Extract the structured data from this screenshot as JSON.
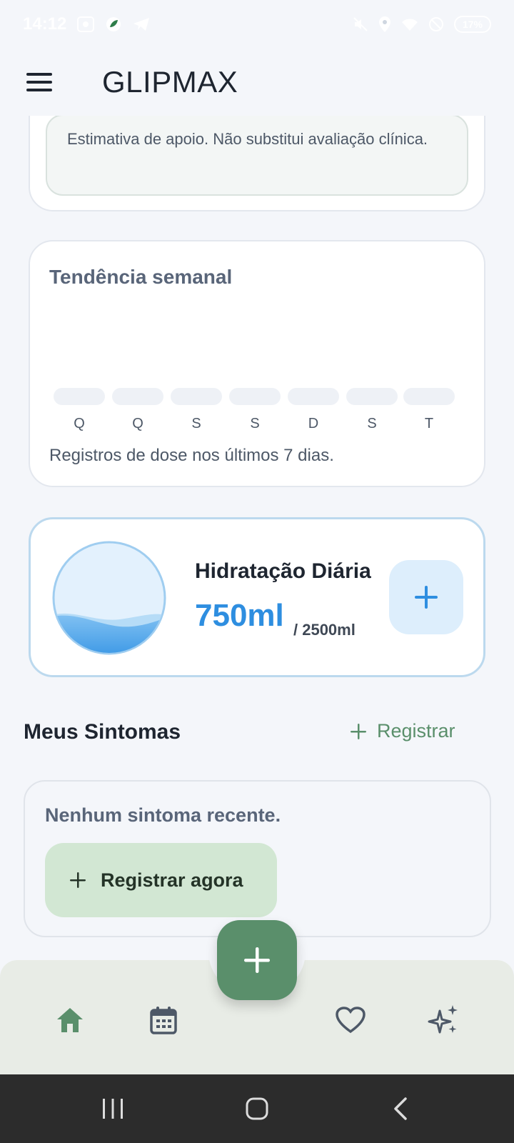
{
  "status_bar": {
    "time": "14:12",
    "battery": "17%"
  },
  "app_bar": {
    "title": "GLIPMAX",
    "menu_icon": "menu-icon"
  },
  "notice": {
    "text": "Estimativa de apoio. Não substitui avaliação clínica."
  },
  "trend": {
    "title": "Tendência semanal",
    "days": [
      "Q",
      "Q",
      "S",
      "S",
      "D",
      "S",
      "T"
    ],
    "caption": "Registros de dose nos últimos 7 dias."
  },
  "hydration": {
    "title": "Hidratação Diária",
    "amount": "750ml",
    "goal": "/ 2500ml",
    "fill_fraction": 0.3,
    "accent": "#2e8ee0"
  },
  "symptoms": {
    "title": "Meus Sintomas",
    "register_link": "Registrar",
    "empty_text": "Nenhum sintoma recente.",
    "register_now": "Registrar agora"
  },
  "bottom_nav": {
    "items": [
      "home-icon",
      "calendar-icon",
      "heart-icon",
      "sparkles-icon"
    ],
    "fab_icon": "plus-icon",
    "active_color": "#5a8f6b"
  },
  "system_nav": {
    "buttons": [
      "recent-apps-icon",
      "home-circle-icon",
      "back-icon"
    ]
  }
}
